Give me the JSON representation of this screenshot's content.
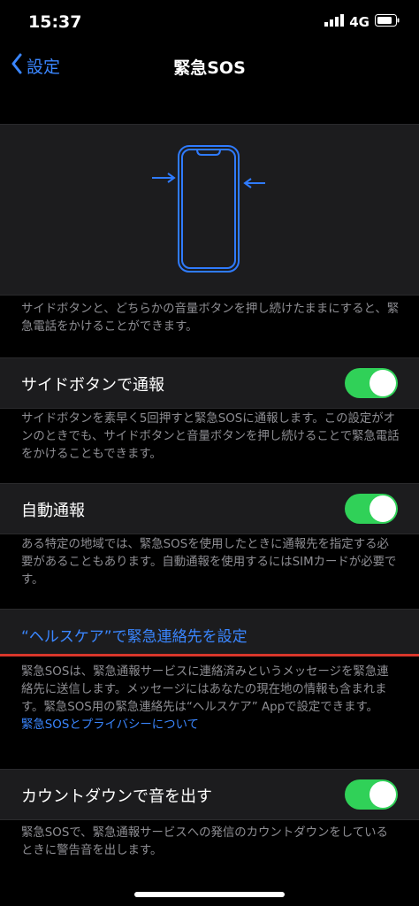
{
  "status": {
    "time": "15:37",
    "network": "4G"
  },
  "nav": {
    "back_label": "設定",
    "title": "緊急SOS"
  },
  "illustration_caption": "サイドボタンと、どちらかの音量ボタンを押し続けたままにすると、緊急電話をかけることができます。",
  "rows": {
    "call_with_side": {
      "label": "サイドボタンで通報",
      "on": true,
      "footer": "サイドボタンを素早く5回押すと緊急SOSに通報します。この設定がオンのときでも、サイドボタンと音量ボタンを押し続けることで緊急電話をかけることもできます。"
    },
    "auto_call": {
      "label": "自動通報",
      "on": true,
      "footer": "ある特定の地域では、緊急SOSを使用したときに通報先を指定する必要があることもあります。自動通報を使用するにはSIMカードが必要です。"
    },
    "health": {
      "label": "“ヘルスケア”で緊急連絡先を設定",
      "footer": "緊急SOSは、緊急通報サービスに連絡済みというメッセージを緊急連絡先に送信します。メッセージにはあなたの現在地の情報も含まれます。緊急SOS用の緊急連絡先は“ヘルスケア” Appで設定できます。",
      "privacy_link": "緊急SOSとプライバシーについて"
    },
    "countdown": {
      "label": "カウントダウンで音を出す",
      "on": true,
      "footer": "緊急SOSで、緊急通報サービスへの発信のカウントダウンをしているときに警告音を出します。"
    }
  },
  "colors": {
    "accent": "#3a86ff",
    "toggle_on": "#30d158",
    "annotation": "#d9372b"
  }
}
